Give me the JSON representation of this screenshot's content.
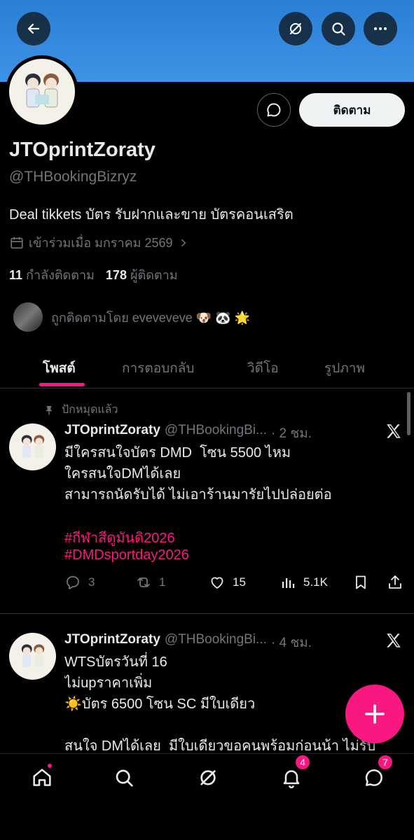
{
  "profile": {
    "display_name": "JTOprintZoraty",
    "handle": "@THBookingBizryz",
    "bio": "Deal tikkets บัตร รับฝากและขาย บัตรคอนเสริต",
    "joined": "เข้าร่วมเมื่อ มกราคม 2569",
    "following_count": "11",
    "following_label": "กำลังติดตาม",
    "followers_count": "178",
    "followers_label": "ผู้ติดตาม",
    "followed_by_text": "ถูกติดตามโดย eveveveve 🐶 🐼 🌟",
    "follow_button": "ติดตาม"
  },
  "tabs": [
    {
      "label": "โพสต์",
      "active": true
    },
    {
      "label": "การตอบกลับ",
      "active": false
    },
    {
      "label": "วิดีโอ",
      "active": false
    },
    {
      "label": "รูปภาพ",
      "active": false
    }
  ],
  "pinned_label": "ปักหมุดแล้ว",
  "posts": [
    {
      "name": "JTOprintZoraty",
      "handle": "@THBookingBi...",
      "time": "· 2 ชม.",
      "lines": "มีใครสนใจบัตร DMD  โซน 5500 ไหม\nใครสนใจDMได้เลย\nสามารถนัดรับได้ ไม่เอาร้านมารัยไปปล่อยต่อ",
      "hashtags": [
        "#กีฬาสีดูมันดิ2026",
        "#DMDsportday2026"
      ],
      "replies": "3",
      "reposts": "1",
      "likes": "15",
      "views": "5.1K"
    },
    {
      "name": "JTOprintZoraty",
      "handle": "@THBookingBi...",
      "time": "· 4 ชม.",
      "lines": "WTSบัตรวันที่ 16\nไม่upราคาเพิ่ม\n☀️บัตร 6500 โซน SC มีใบเดียว\n\nสนใจ DMได้เลย  มีใบเดียวขอคนพร้อมก่อนน้า ไม่รับ"
    }
  ],
  "nav": {
    "notifications_badge": "4",
    "messages_badge": "7"
  },
  "colors": {
    "accent": "#f91880",
    "banner": "#3f93e6",
    "muted": "#71767b"
  }
}
